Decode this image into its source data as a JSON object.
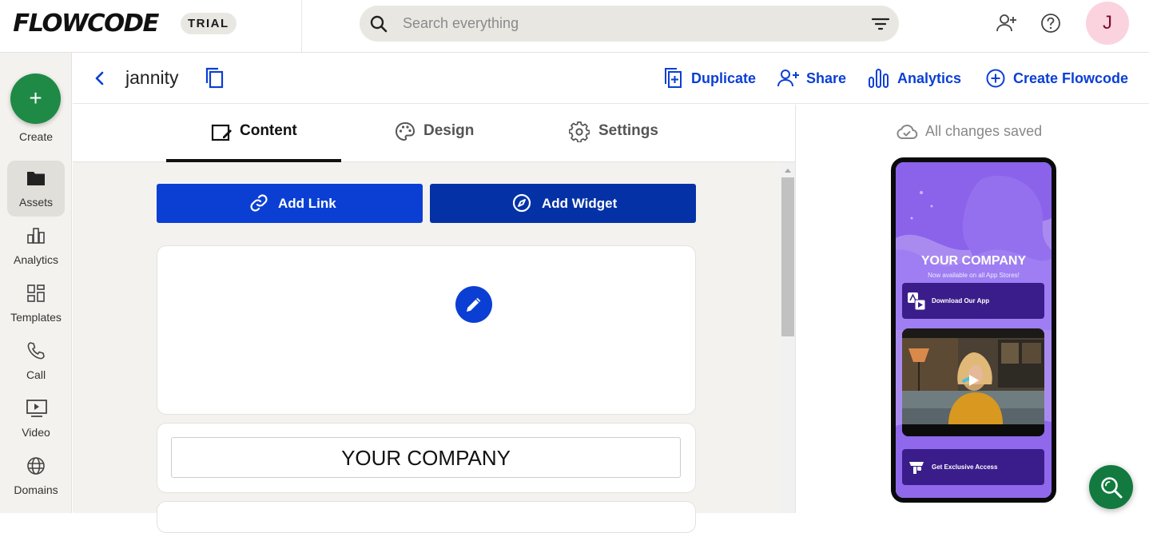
{
  "app": {
    "logo": "FLOWCODE",
    "plan_badge": "TRIAL",
    "avatar_initial": "J"
  },
  "search": {
    "placeholder": "Search everything",
    "value": ""
  },
  "sidebar": {
    "create_label": "Create",
    "items": [
      {
        "label": "Assets",
        "icon": "folder-icon",
        "active": true
      },
      {
        "label": "Analytics",
        "icon": "bar-chart-icon",
        "active": false
      },
      {
        "label": "Templates",
        "icon": "templates-icon",
        "active": false
      },
      {
        "label": "Call",
        "icon": "phone-icon",
        "active": false
      },
      {
        "label": "Video",
        "icon": "video-icon",
        "active": false
      },
      {
        "label": "Domains",
        "icon": "globe-icon",
        "active": false
      }
    ]
  },
  "asset": {
    "name": "jannity",
    "actions": {
      "duplicate": "Duplicate",
      "share": "Share",
      "analytics": "Analytics",
      "create_flowcode": "Create Flowcode"
    }
  },
  "editor": {
    "tabs": [
      {
        "label": "Content",
        "active": true
      },
      {
        "label": "Design",
        "active": false
      },
      {
        "label": "Settings",
        "active": false
      }
    ],
    "add_link": "Add Link",
    "add_widget": "Add Widget",
    "company_name": "YOUR COMPANY"
  },
  "preview": {
    "status": "All changes saved",
    "title": "YOUR COMPANY",
    "subtitle": "Now available on all App Stores!",
    "buttons": [
      "Download Our App",
      "Get Exclusive Access"
    ]
  },
  "colors": {
    "accent": "#0b3fd4",
    "accent_dark": "#0432a6",
    "create_green": "#1e8a45",
    "phone_purple": "#a98bf0",
    "phone_button": "#3a1d8a"
  }
}
